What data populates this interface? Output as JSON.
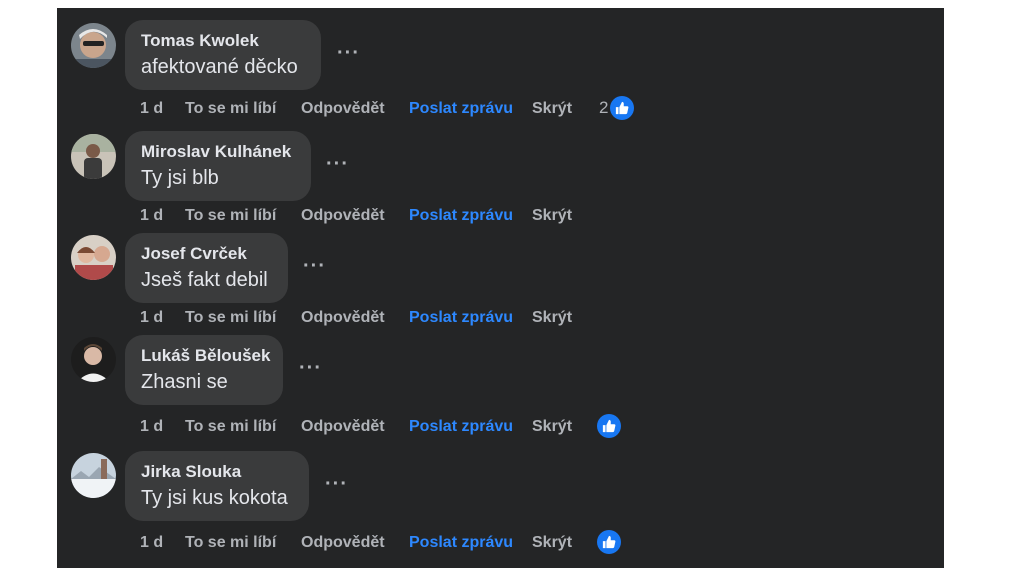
{
  "colors": {
    "background": "#242526",
    "bubble": "#3a3b3c",
    "text": "#e4e6eb",
    "muted": "#b0b3b8",
    "link": "#2d88ff",
    "like": "#1877f2"
  },
  "actions": {
    "like": "To se mi líbí",
    "reply": "Odpovědět",
    "send_message": "Poslat zprávu",
    "hide": "Skrýt"
  },
  "comments": [
    {
      "author": "Tomas Kwolek",
      "text": "afektované děcko",
      "time": "1 d",
      "reaction_icon": "like-icon",
      "reaction_count": "2"
    },
    {
      "author": "Miroslav Kulhánek",
      "text": "Ty jsi blb",
      "time": "1 d"
    },
    {
      "author": "Josef Cvrček",
      "text": "Jseš fakt debil",
      "time": "1 d"
    },
    {
      "author": "Lukáš Běloušek",
      "text": "Zhasni se",
      "time": "1 d",
      "reaction_icon": "like-icon"
    },
    {
      "author": "Jirka Slouka",
      "text": "Ty jsi kus kokota",
      "time": "1 d",
      "reaction_icon": "like-icon"
    }
  ]
}
